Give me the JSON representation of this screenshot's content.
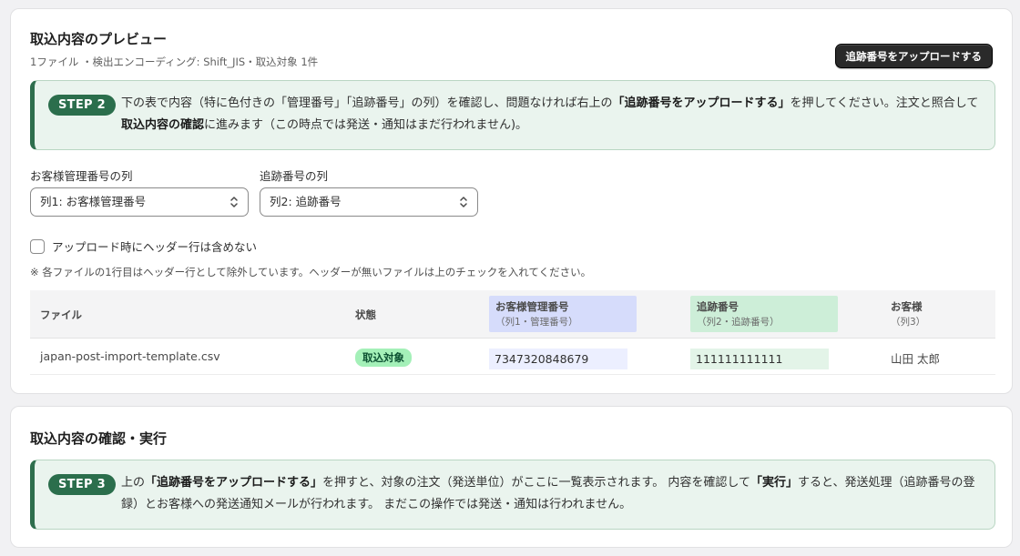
{
  "preview": {
    "title": "取込内容のプレビュー",
    "subtitle": "1ファイル ・検出エンコーディング: Shift_JIS・取込対象 1件",
    "upload_button": "追跡番号をアップロードする",
    "step": {
      "label": "STEP 2",
      "t1": "下の表で内容（特に色付きの「管理番号」「追跡番号」の列）を確認し、問題なければ右上の",
      "b1": "「追跡番号をアップロードする」",
      "t2": "を押してください。注文と照合して",
      "b2": "取込内容の確認",
      "t3": "に進みます（この時点では発送・通知はまだ行われません)。"
    },
    "customer_col_label": "お客様管理番号の列",
    "customer_col_value": "列1: お客様管理番号",
    "tracking_col_label": "追跡番号の列",
    "tracking_col_value": "列2: 追跡番号",
    "checkbox_label": "アップロード時にヘッダー行は含めない",
    "note": "※ 各ファイルの1行目はヘッダー行として除外しています。ヘッダーが無いファイルは上のチェックを入れてください。",
    "table": {
      "headers": {
        "file": "ファイル",
        "status": "状態",
        "customer_no": "お客様管理番号",
        "customer_no_sub": "（列1・管理番号）",
        "tracking_no": "追跡番号",
        "tracking_no_sub": "（列2・追跡番号）",
        "customer": "お客様",
        "customer_sub": "（列3）"
      },
      "rows": [
        {
          "file": "japan-post-import-template.csv",
          "status": "取込対象",
          "customer_no": "7347320848679",
          "tracking_no": "111111111111",
          "customer": "山田 太郎"
        }
      ]
    }
  },
  "confirm": {
    "title": "取込内容の確認・実行",
    "step": {
      "label": "STEP 3",
      "t1": "上の",
      "b1": "「追跡番号をアップロードする」",
      "t2": "を押すと、対象の注文（発送単位）がここに一覧表示されます。 内容を確認して",
      "b2": "「実行」",
      "t3": "すると、発送処理（追跡番号の登録）とお客様への発送通知メールが行われます。 まだこの操作では発送・通知は行われません。"
    }
  },
  "colors": {
    "customer_highlight_header": "#d6dcfb",
    "customer_highlight_cell": "#ecefff",
    "tracking_highlight_header": "#cdeed8",
    "tracking_highlight_cell": "#e3f4e8",
    "step_pill": "#2b6e4c"
  },
  "icons": {
    "select_chevron": "chevron-up-down-icon"
  }
}
